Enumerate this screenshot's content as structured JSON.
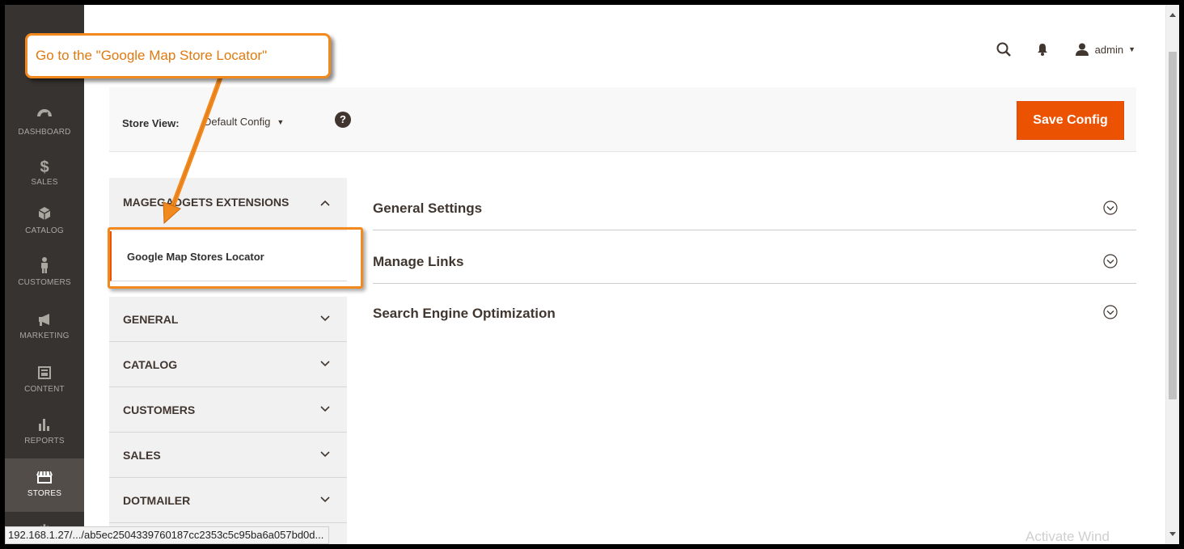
{
  "admin_menu": {
    "items": [
      {
        "label": "Dashboard",
        "icon": "dashboard-icon"
      },
      {
        "label": "Sales",
        "icon": "dollar-icon"
      },
      {
        "label": "Catalog",
        "icon": "box-icon"
      },
      {
        "label": "Customers",
        "icon": "person-icon"
      },
      {
        "label": "Marketing",
        "icon": "megaphone-icon"
      },
      {
        "label": "Content",
        "icon": "layout-icon"
      },
      {
        "label": "Reports",
        "icon": "bar-chart-icon"
      },
      {
        "label": "Stores",
        "icon": "storefront-icon"
      }
    ],
    "active_item": "Stores"
  },
  "header": {
    "user_name": "admin",
    "icons": [
      "search-icon",
      "bell-icon",
      "user-icon"
    ]
  },
  "page_actions": {
    "store_view_label": "Store View:",
    "store_view_value": "Default Config",
    "save_button_label": "Save Config"
  },
  "config_tabs": {
    "groups": [
      {
        "title": "MAGEGADGETS EXTENSIONS",
        "expanded": true,
        "items": [
          "Google Map Stores Locator"
        ]
      },
      {
        "title": "GENERAL",
        "expanded": false
      },
      {
        "title": "CATALOG",
        "expanded": false
      },
      {
        "title": "CUSTOMERS",
        "expanded": false
      },
      {
        "title": "SALES",
        "expanded": false
      },
      {
        "title": "DOTMAILER",
        "expanded": false
      }
    ]
  },
  "sections": [
    {
      "title": "General Settings"
    },
    {
      "title": "Manage Links"
    },
    {
      "title": "Search Engine Optimization"
    }
  ],
  "annotation": {
    "callout_text": "Go to the \"Google Map Store Locator\"",
    "color": "#f2891e"
  },
  "status_bar": {
    "url": "192.168.1.27/.../ab5ec2504339760187cc2353c5c95ba6a057bd0d..."
  },
  "colors": {
    "accent": "#eb5202",
    "menu_bg": "#373330",
    "menu_active_bg": "#524d49",
    "annotation": "#f2891e"
  }
}
